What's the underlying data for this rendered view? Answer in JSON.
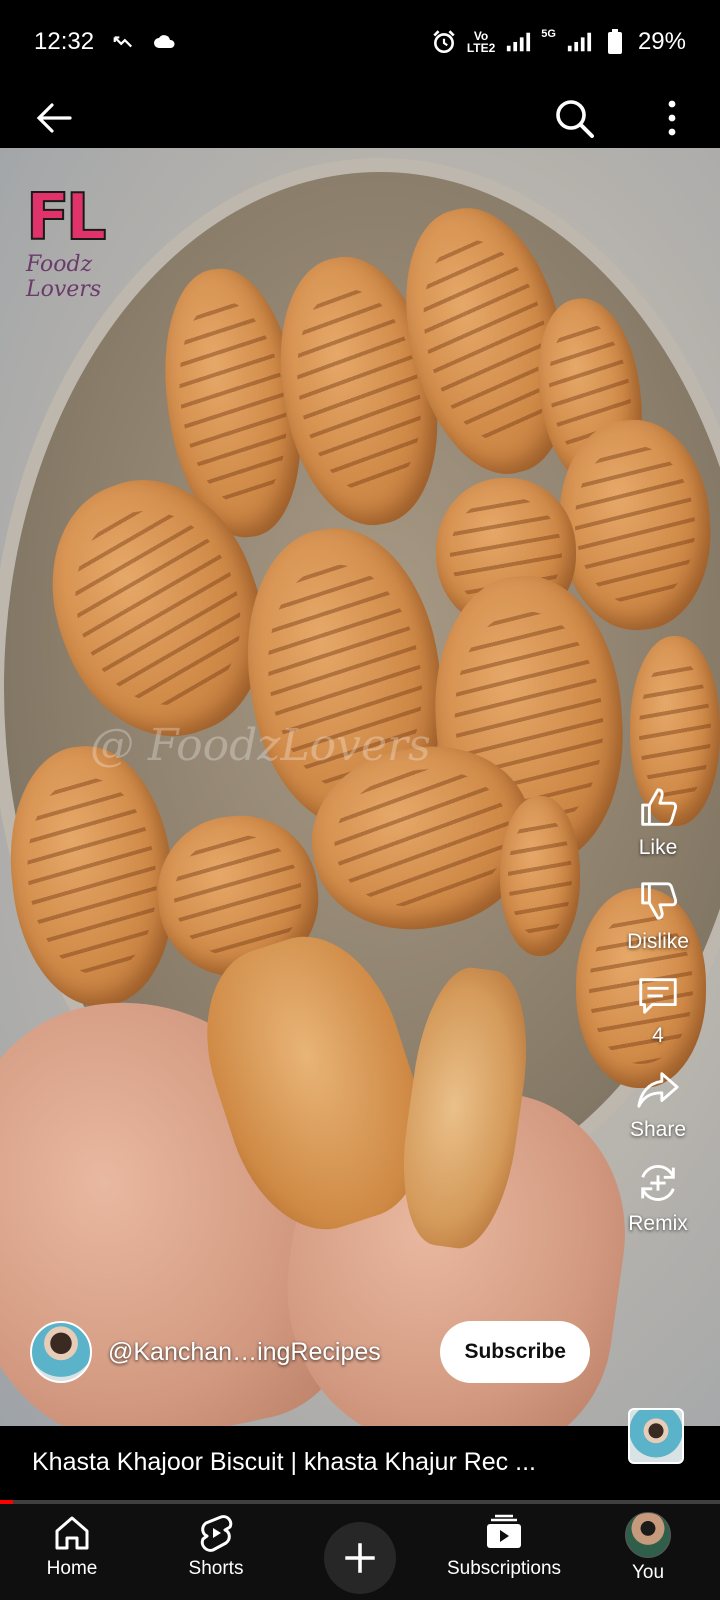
{
  "status_bar": {
    "time": "12:32",
    "volte_top": "Vo",
    "volte_bottom": "LTE2",
    "network": "5G",
    "battery": "29%"
  },
  "top_bar": {
    "icons": [
      "back-arrow-icon",
      "search-icon",
      "more-vertical-icon"
    ]
  },
  "video": {
    "logo_letters": "FL",
    "logo_text": "Foodz Lovers",
    "watermark": "@ FoodzLovers"
  },
  "actions": {
    "like_label": "Like",
    "dislike_label": "Dislike",
    "comments_count": "4",
    "share_label": "Share",
    "remix_label": "Remix"
  },
  "channel": {
    "name": "@Kanchan…ingRecipes",
    "subscribe_label": "Subscribe"
  },
  "title": "Khasta Khajoor Biscuit | khasta Khajur Rec ...",
  "progress": {
    "fraction": 0.018,
    "color": "#ff0000"
  },
  "bottom_nav": {
    "home": "Home",
    "shorts": "Shorts",
    "subscriptions": "Subscriptions",
    "you": "You"
  }
}
